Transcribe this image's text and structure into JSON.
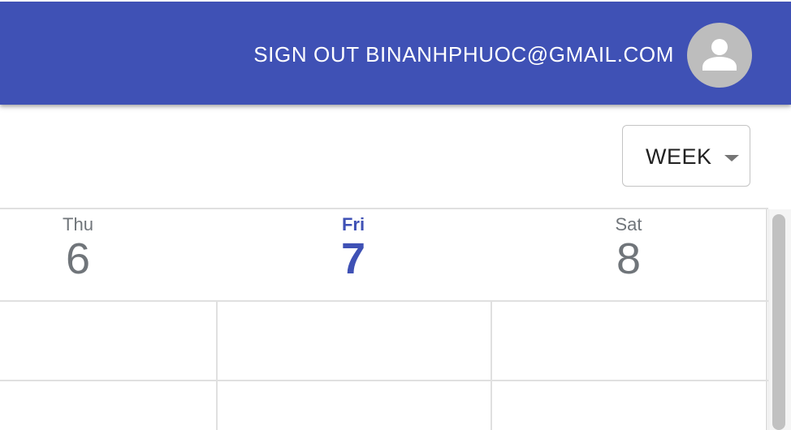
{
  "header": {
    "signout_label": "SIGN OUT",
    "user_email": "BINANHPHUOC@GMAIL.COM",
    "color": "#3f51b5",
    "avatar_icon": "person-icon"
  },
  "view_selector": {
    "value": "WEEK",
    "icon": "chevron-down-icon"
  },
  "days": [
    {
      "name": "Thu",
      "number": "6",
      "today": false
    },
    {
      "name": "Fri",
      "number": "7",
      "today": true
    },
    {
      "name": "Sat",
      "number": "8",
      "today": false
    }
  ],
  "accent_color": "#3f51b5"
}
